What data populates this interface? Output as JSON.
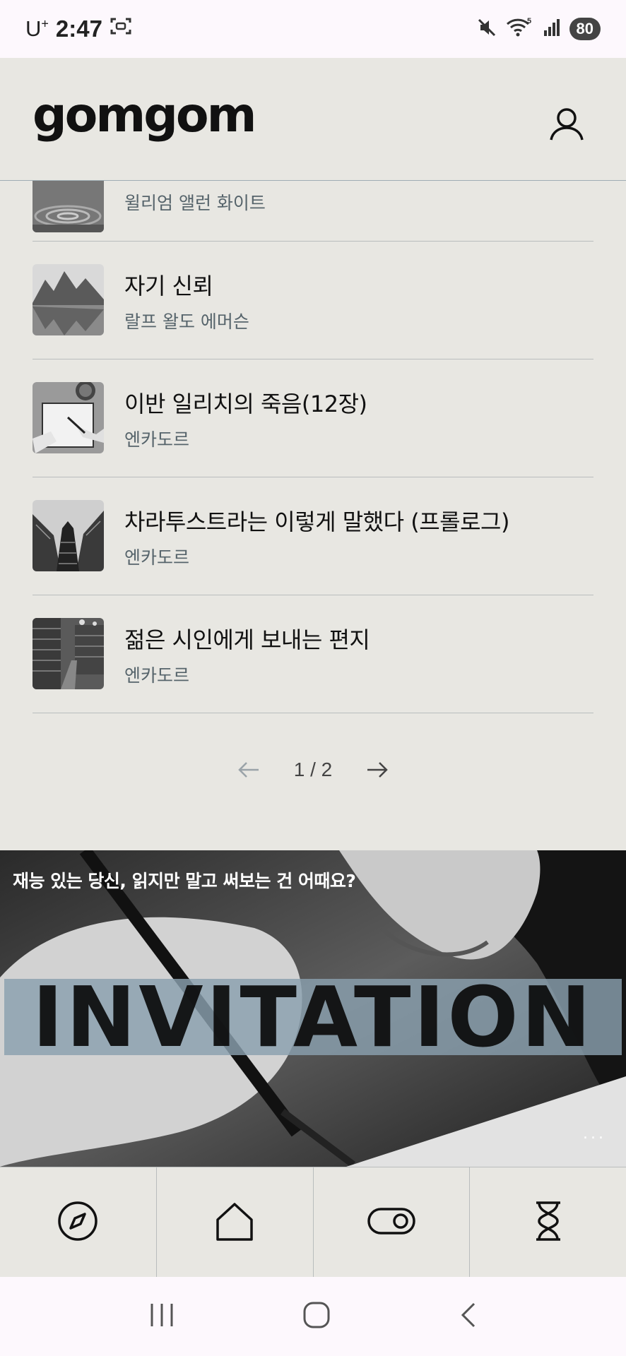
{
  "status_bar": {
    "carrier": "U",
    "carrier_sup": "+",
    "time": "2:47",
    "battery": "80",
    "wifi_badge": "5"
  },
  "header": {
    "logo": "gomgom",
    "profile_icon": "user-icon"
  },
  "list": [
    {
      "title": "",
      "author": "윌리엄 앨런 화이트",
      "thumb": "ripple-water"
    },
    {
      "title": "자기 신뢰",
      "author": "랄프 왈도 에머슨",
      "thumb": "mountain-lake"
    },
    {
      "title": "이반 일리치의 죽음(12장)",
      "author": "엔카도르",
      "thumb": "writing-notebook"
    },
    {
      "title": "차라투스트라는 이렇게 말했다 (프롤로그)",
      "author": "엔카도르",
      "thumb": "skyscrapers"
    },
    {
      "title": "젊은 시인에게 보내는 편지",
      "author": "엔카도르",
      "thumb": "library"
    }
  ],
  "pagination": {
    "text": "1 / 2",
    "current": 1,
    "total": 2
  },
  "banner": {
    "caption": "재능 있는 당신, 읽지만 말고 써보는 건 어때요?",
    "headline": "INVITATION",
    "more": "..."
  },
  "tabs": [
    {
      "icon": "compass-icon"
    },
    {
      "icon": "home-icon"
    },
    {
      "icon": "toggle-icon"
    },
    {
      "icon": "hourglass-icon"
    }
  ],
  "system_nav": [
    "recents-icon",
    "home-circle-icon",
    "back-icon"
  ],
  "colors": {
    "background": "#e8e7e2",
    "divider": "#b9bdbd",
    "author_text": "#56646b",
    "banner_strip": "#8aa0af",
    "system_bar": "#fdf8fd"
  }
}
